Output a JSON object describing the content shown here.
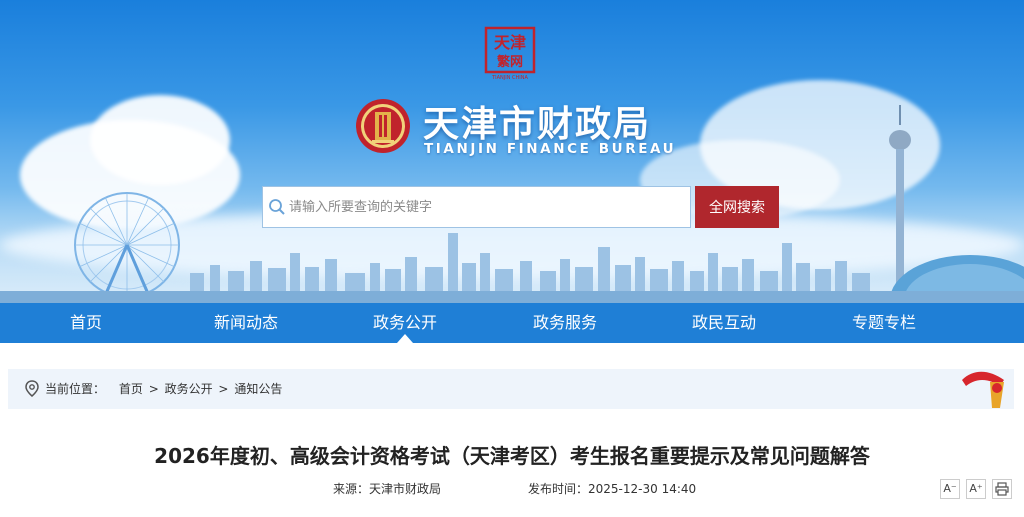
{
  "header": {
    "seal_text": "天津",
    "seal_small": "TIANJIN CHINA",
    "site_name_cn": "天津市财政局",
    "site_name_en": "TIANJIN FINANCE BUREAU"
  },
  "search": {
    "placeholder": "请输入所要查询的关键字",
    "value": "",
    "button_label": "全网搜索"
  },
  "nav": {
    "active_index": 2,
    "items": [
      {
        "label": "首页"
      },
      {
        "label": "新闻动态"
      },
      {
        "label": "政务公开"
      },
      {
        "label": "政务服务"
      },
      {
        "label": "政民互动"
      },
      {
        "label": "专题专栏"
      }
    ]
  },
  "breadcrumb": {
    "prefix": "当前位置：",
    "items": [
      "首页",
      "政务公开",
      "通知公告"
    ],
    "separator": ">"
  },
  "article": {
    "title": "2026年度初、高级会计资格考试（天津考区）考生报名重要提示及常见问题解答",
    "source_label": "来源：",
    "source": "天津市财政局",
    "date_label": "发布时间：",
    "date": "2025-12-30 14:40"
  },
  "tools": {
    "font_decrease": "A⁻",
    "font_increase": "A⁺",
    "print_icon": "print-icon"
  },
  "colors": {
    "nav_bg": "#1f7fd6",
    "search_button": "#b0272d",
    "breadcrumb_bg": "#eef4fb"
  }
}
